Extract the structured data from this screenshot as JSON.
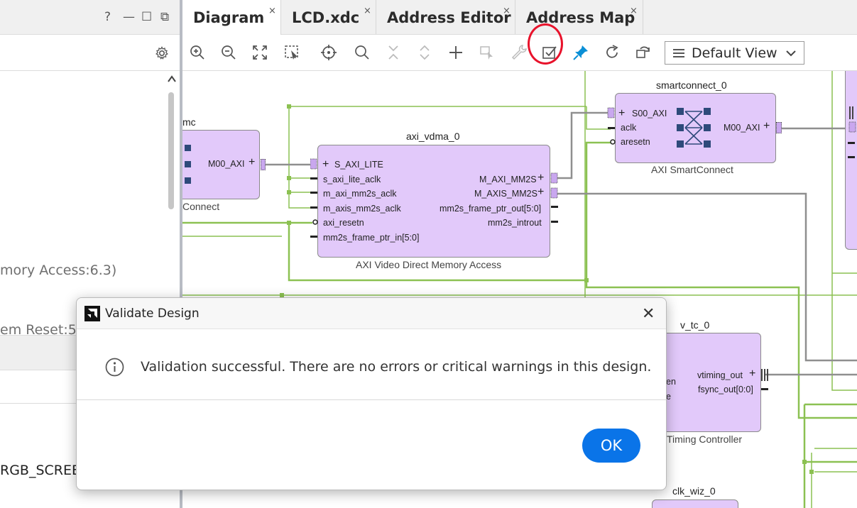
{
  "left_panel": {
    "window_buttons": {
      "help": "?",
      "minimize": "—",
      "maximize": "☐",
      "float": "⧉"
    },
    "text_memory_access": "mory Access:6.3)",
    "text_reset": "em Reset:5",
    "text_rgb": "RGB_SCREE"
  },
  "tabs": [
    {
      "label": "Diagram",
      "active": true
    },
    {
      "label": "LCD.xdc",
      "active": false
    },
    {
      "label": "Address Editor",
      "active": false
    },
    {
      "label": "Address Map",
      "active": false
    }
  ],
  "tab_close_glyph": "×",
  "toolbar": {
    "view_select_value": "Default View",
    "tools": [
      "zoom-in-icon",
      "zoom-out-icon",
      "fit-icon",
      "select-area-icon",
      "target-icon",
      "search-icon",
      "collapse-icon",
      "expand-icon",
      "add-ip-icon",
      "crop-icon",
      "wrench-icon",
      "validate-icon",
      "pin-icon",
      "refresh-icon",
      "regenerate-icon"
    ],
    "accent_color": "#0a8fd6",
    "annotation_color": "#e8122b"
  },
  "diagram": {
    "mc_block": {
      "name": "mc",
      "subtitle": "Connect",
      "ports": [
        "M00_AXI"
      ]
    },
    "vdma": {
      "name": "axi_vdma_0",
      "subtitle": "AXI Video Direct Memory Access",
      "left_ports": [
        "S_AXI_LITE",
        "s_axi_lite_aclk",
        "m_axi_mm2s_aclk",
        "m_axis_mm2s_aclk",
        "axi_resetn",
        "mm2s_frame_ptr_in[5:0]"
      ],
      "right_ports": [
        "M_AXI_MM2S",
        "M_AXIS_MM2S",
        "mm2s_frame_ptr_out[5:0]",
        "mm2s_introut"
      ]
    },
    "smartconnect": {
      "name": "smartconnect_0",
      "subtitle": "AXI SmartConnect",
      "left_ports": [
        "S00_AXI",
        "aclk",
        "aresetn"
      ],
      "right_ports": [
        "M00_AXI"
      ]
    },
    "vtc": {
      "name": "v_tc_0",
      "subtitle": "Timing Controller",
      "left_ports": [
        "en",
        "e"
      ],
      "right_ports": [
        "vtiming_out",
        "fsync_out[0:0]"
      ]
    },
    "clk_wiz": {
      "name": "clk_wiz_0"
    },
    "colors": {
      "block_fill": "#e2c9fa",
      "net_green": "#8cc152",
      "net_gray": "#8f8f8f",
      "port_blue": "#2e4a7a"
    }
  },
  "dialog": {
    "title": "Validate Design",
    "message": "Validation successful. There are no errors or critical warnings in this design.",
    "ok_label": "OK",
    "close_glyph": "✕",
    "button_color": "#0a74e8"
  }
}
